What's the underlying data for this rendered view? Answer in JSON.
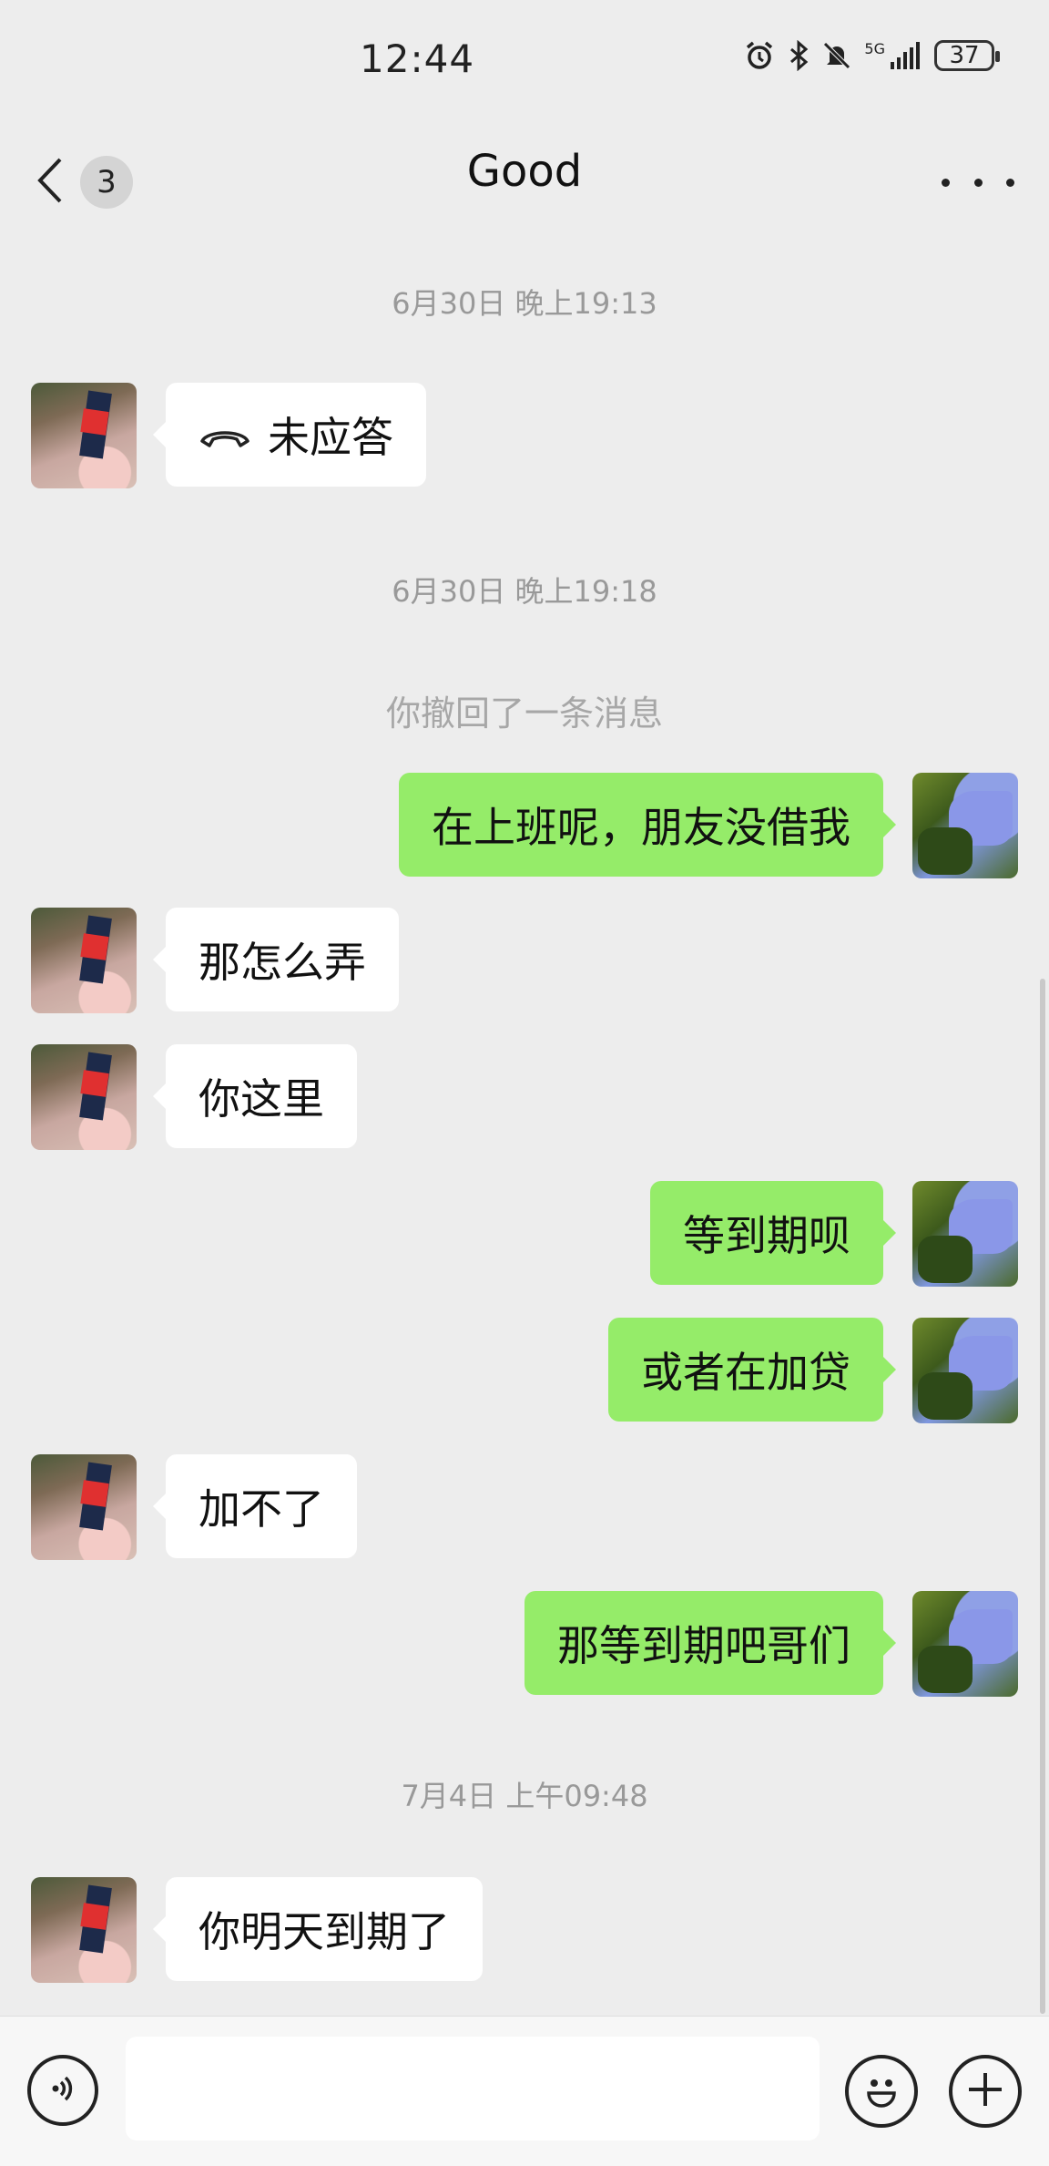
{
  "status_bar": {
    "time": "12:44",
    "network": "5G",
    "battery": "37",
    "icons": [
      "alarm-icon",
      "bluetooth-icon",
      "mute-icon",
      "signal-icon",
      "battery-icon"
    ]
  },
  "nav": {
    "back_icon": "chevron-left-icon",
    "unread_badge": "3",
    "title": "Good",
    "more_icon": "more-icon"
  },
  "messages": [
    {
      "type": "timestamp",
      "text": "6月30日 晚上19:13"
    },
    {
      "type": "call",
      "side": "left",
      "icon": "phone-hangup-icon",
      "text": "未应答"
    },
    {
      "type": "timestamp",
      "text": "6月30日 晚上19:18"
    },
    {
      "type": "system",
      "text": "你撤回了一条消息"
    },
    {
      "type": "text",
      "side": "right",
      "text": "在上班呢，朋友没借我"
    },
    {
      "type": "text",
      "side": "left",
      "text": "那怎么弄"
    },
    {
      "type": "text",
      "side": "left",
      "text": "你这里"
    },
    {
      "type": "text",
      "side": "right",
      "text": "等到期呗"
    },
    {
      "type": "text",
      "side": "right",
      "text": "或者在加贷"
    },
    {
      "type": "text",
      "side": "left",
      "text": "加不了"
    },
    {
      "type": "text",
      "side": "right",
      "text": "那等到期吧哥们"
    },
    {
      "type": "timestamp",
      "text": "7月4日 上午09:48"
    },
    {
      "type": "text",
      "side": "left",
      "text": "你明天到期了"
    }
  ],
  "input_bar": {
    "voice_icon": "voice-icon",
    "text_value": "",
    "emoji_icon": "emoji-icon",
    "plus_icon": "plus-icon"
  },
  "colors": {
    "background": "#ededed",
    "sent_bubble": "#95ec69",
    "received_bubble": "#ffffff",
    "timestamp_text": "#999999"
  }
}
